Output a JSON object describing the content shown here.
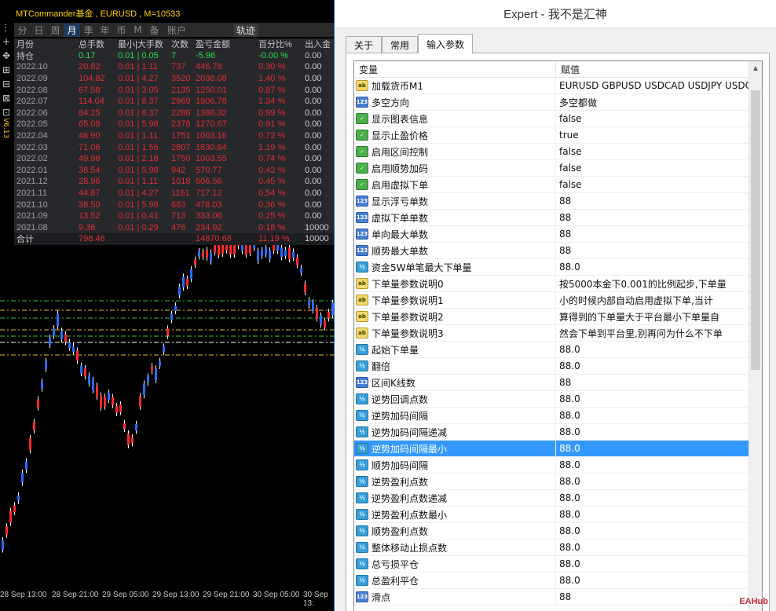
{
  "chart": {
    "title": "MTCommander基金 , EURUSD , M=10533",
    "version": "V6.13",
    "toolstrip": [
      "⋮⋮",
      "+",
      "✥",
      "⊞",
      "⊟",
      "⊠",
      "⊡"
    ],
    "periods": [
      "分",
      "日",
      "周",
      "月",
      "季",
      "年",
      "币",
      "M",
      "备",
      "账户"
    ],
    "active_period": "月",
    "trail_label": "轨迹",
    "stats_header": [
      "月份",
      "总手数",
      "最小|大手数",
      "次数",
      "盈亏金额",
      "百分比%",
      "出入金"
    ],
    "holding": [
      "持仓",
      "0.17",
      "0.01 | 0.05",
      "7",
      "-5.96",
      "-0.00 %",
      "0.00"
    ],
    "months": [
      [
        "2022.10",
        "20.82",
        "0.01 | 1.11",
        "737",
        "446.78",
        "0.30 %",
        "0.00"
      ],
      [
        "2022.09",
        "104.82",
        "0.01 | 4.27",
        "3520",
        "2038.08",
        "1.40 %",
        "0.00"
      ],
      [
        "2022.08",
        "67.58",
        "0.01 | 3.05",
        "2135",
        "1250.01",
        "0.87 %",
        "0.00"
      ],
      [
        "2022.07",
        "114.04",
        "0.01 | 8.37",
        "2969",
        "1906.78",
        "1.34 %",
        "0.00"
      ],
      [
        "2022.06",
        "84.25",
        "0.01 | 8.37",
        "2286",
        "1386.32",
        "0.99 %",
        "0.00"
      ],
      [
        "2022.05",
        "65.09",
        "0.01 | 5.98",
        "2378",
        "1270.67",
        "0.91 %",
        "0.00"
      ],
      [
        "2022.04",
        "46.90",
        "0.01 | 1.11",
        "1751",
        "1003.16",
        "0.72 %",
        "0.00"
      ],
      [
        "2022.03",
        "71.06",
        "0.01 | 1.56",
        "2807",
        "1630.84",
        "1.19 %",
        "0.00"
      ],
      [
        "2022.02",
        "49.98",
        "0.01 | 2.18",
        "1750",
        "1003.55",
        "0.74 %",
        "0.00"
      ],
      [
        "2022.01",
        "38.54",
        "0.01 | 5.98",
        "942",
        "570.77",
        "0.42 %",
        "0.00"
      ],
      [
        "2021.12",
        "28.96",
        "0.01 | 1.11",
        "1018",
        "606.56",
        "0.45 %",
        "0.00"
      ],
      [
        "2021.11",
        "44.87",
        "0.01 | 4.27",
        "1161",
        "717.12",
        "0.54 %",
        "0.00"
      ],
      [
        "2021.10",
        "38.50",
        "0.01 | 5.98",
        "683",
        "478.03",
        "0.36 %",
        "0.00"
      ],
      [
        "2021.09",
        "13.52",
        "0.01 | 0.41",
        "713",
        "333.06",
        "0.25 %",
        "0.00"
      ],
      [
        "2021.08",
        "9.36",
        "0.01 | 0.29",
        "476",
        "234.92",
        "0.18 %",
        "10000"
      ]
    ],
    "total": [
      "合计",
      "798.46",
      "",
      "",
      "14870.68",
      "11.19 %",
      "10000"
    ],
    "time_labels": [
      "28 Sep 13:00",
      "28 Sep 21:00",
      "29 Sep 05:00",
      "29 Sep 13:00",
      "29 Sep 21:00",
      "30 Sep 05:00",
      "30 Sep 13:"
    ],
    "colors": {
      "up": "#ff2a2a",
      "down": "#2a6bff",
      "wick": "#ffffff",
      "level_green": "#3fbf3f",
      "level_yellow": "#e0c020"
    }
  },
  "dialog": {
    "title": "Expert - 我不是汇神",
    "tabs": [
      "关于",
      "常用",
      "输入参数"
    ],
    "active_tab": "输入参数",
    "col_variable": "变量",
    "col_value": "赋值",
    "params": [
      {
        "icon": "ab",
        "icon_text": "ab",
        "name": "加载货币M1",
        "value": "EURUSD GBPUSD USDCAD USDJPY USDC..."
      },
      {
        "icon": "n123",
        "icon_text": "123",
        "name": "多空方向",
        "value": "多空都做"
      },
      {
        "icon": "bool",
        "icon_text": "✓",
        "name": "显示图表信息",
        "value": "false"
      },
      {
        "icon": "bool",
        "icon_text": "✓",
        "name": "显示止盈价格",
        "value": "true"
      },
      {
        "icon": "bool",
        "icon_text": "✓",
        "name": "启用区间控制",
        "value": "false"
      },
      {
        "icon": "bool",
        "icon_text": "✓",
        "name": "启用顺势加码",
        "value": "false"
      },
      {
        "icon": "bool",
        "icon_text": "✓",
        "name": "启用虚拟下单",
        "value": "false"
      },
      {
        "icon": "n123",
        "icon_text": "123",
        "name": "显示浮亏单数",
        "value": "88"
      },
      {
        "icon": "n123",
        "icon_text": "123",
        "name": "虚拟下单单数",
        "value": "88"
      },
      {
        "icon": "n123",
        "icon_text": "123",
        "name": "单向最大单数",
        "value": "88"
      },
      {
        "icon": "n123",
        "icon_text": "123",
        "name": "顺势最大单数",
        "value": "88"
      },
      {
        "icon": "v2",
        "icon_text": "½",
        "name": "资金5W单笔最大下单量",
        "value": "88.0"
      },
      {
        "icon": "ab",
        "icon_text": "ab",
        "name": "下单量参数说明0",
        "value": "按5000本金下0.001的比例起步,下单量"
      },
      {
        "icon": "ab",
        "icon_text": "ab",
        "name": "下单量参数说明1",
        "value": "小的时候内部自动启用虚拟下单,当计"
      },
      {
        "icon": "ab",
        "icon_text": "ab",
        "name": "下单量参数说明2",
        "value": "算得到的下单量大于平台最小下单量自"
      },
      {
        "icon": "ab",
        "icon_text": "ab",
        "name": "下单量参数说明3",
        "value": "然会下单到平台里,别再问为什么不下单"
      },
      {
        "icon": "v2",
        "icon_text": "½",
        "name": "起始下单量",
        "value": "88.0"
      },
      {
        "icon": "v2",
        "icon_text": "½",
        "name": "翻倍",
        "value": "88.0"
      },
      {
        "icon": "n123",
        "icon_text": "123",
        "name": "区间K线数",
        "value": "88"
      },
      {
        "icon": "v2",
        "icon_text": "½",
        "name": "逆势回调点数",
        "value": "88.0"
      },
      {
        "icon": "v2",
        "icon_text": "½",
        "name": "逆势加码间隔",
        "value": "88.0"
      },
      {
        "icon": "v2",
        "icon_text": "½",
        "name": "逆势加码间隔递减",
        "value": "88.0"
      },
      {
        "icon": "v2",
        "icon_text": "½",
        "name": "逆势加码间隔最小",
        "value": "88.0"
      },
      {
        "icon": "v2",
        "icon_text": "½",
        "name": "顺势加码间隔",
        "value": "88.0"
      },
      {
        "icon": "v2",
        "icon_text": "½",
        "name": "逆势盈利点数",
        "value": "88.0"
      },
      {
        "icon": "v2",
        "icon_text": "½",
        "name": "逆势盈利点数递减",
        "value": "88.0"
      },
      {
        "icon": "v2",
        "icon_text": "½",
        "name": "逆势盈利点数最小",
        "value": "88.0"
      },
      {
        "icon": "v2",
        "icon_text": "½",
        "name": "顺势盈利点数",
        "value": "88.0"
      },
      {
        "icon": "v2",
        "icon_text": "½",
        "name": "整体移动止损点数",
        "value": "88.0"
      },
      {
        "icon": "v2",
        "icon_text": "½",
        "name": "总亏损平仓",
        "value": "88.0"
      },
      {
        "icon": "v2",
        "icon_text": "½",
        "name": "总盈利平仓",
        "value": "88.0"
      },
      {
        "icon": "n123",
        "icon_text": "123",
        "name": "滑点",
        "value": "88"
      }
    ],
    "selected_param": "逆势加码间隔最小",
    "watermark": "EAHub"
  }
}
